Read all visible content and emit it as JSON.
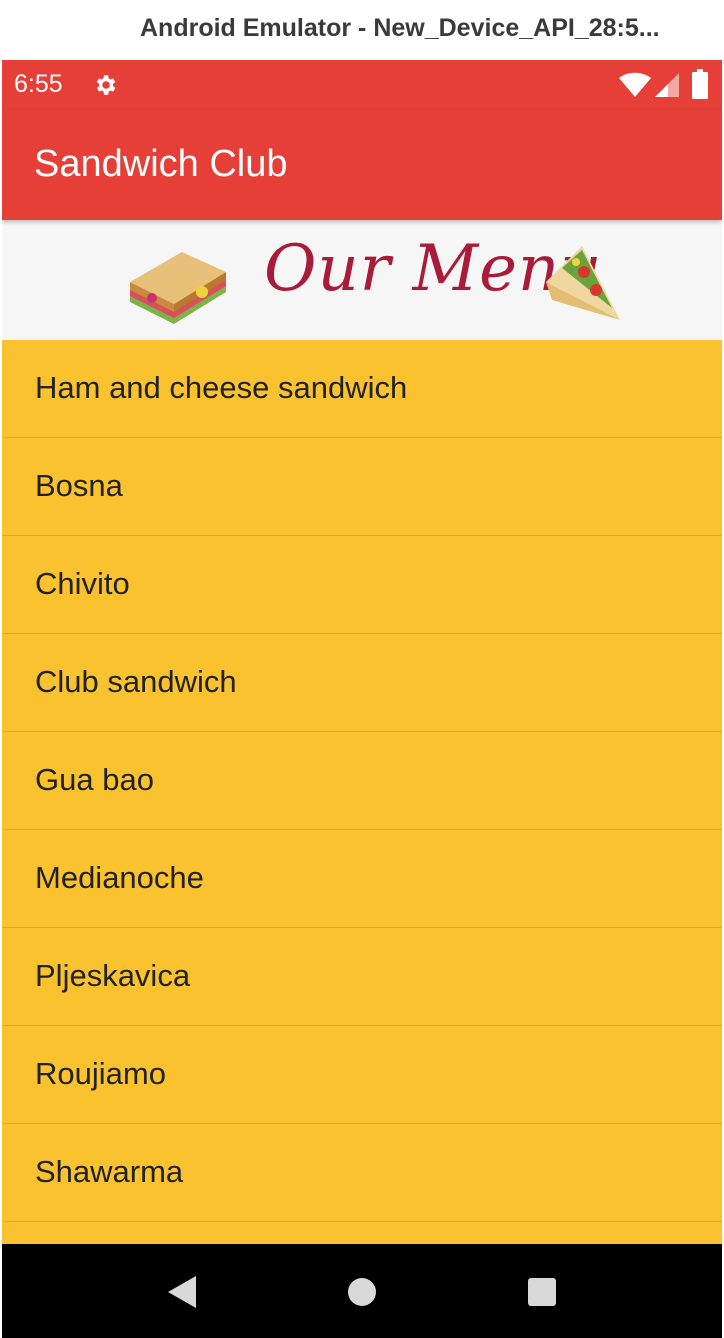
{
  "window": {
    "title": "Android Emulator - New_Device_API_28:5..."
  },
  "status_bar": {
    "time": "6:55",
    "icons": [
      "gear-icon",
      "wifi-icon",
      "signal-icon",
      "battery-icon"
    ]
  },
  "app_bar": {
    "title": "Sandwich Club",
    "color": "#e53f38"
  },
  "banner": {
    "heading": "Our Menu",
    "heading_color": "#a81c3a",
    "icons": [
      "sandwich-icon",
      "wrap-sandwich-icon"
    ]
  },
  "menu": {
    "background_color": "#f9c22e",
    "items": [
      {
        "label": "Ham and cheese sandwich"
      },
      {
        "label": "Bosna"
      },
      {
        "label": "Chivito"
      },
      {
        "label": "Club sandwich"
      },
      {
        "label": "Gua bao"
      },
      {
        "label": "Medianoche"
      },
      {
        "label": "Pljeskavica"
      },
      {
        "label": "Roujiamo"
      },
      {
        "label": "Shawarma"
      },
      {
        "label": ""
      }
    ]
  },
  "nav_bar": {
    "buttons": [
      "back-icon",
      "home-icon",
      "recents-icon"
    ]
  }
}
